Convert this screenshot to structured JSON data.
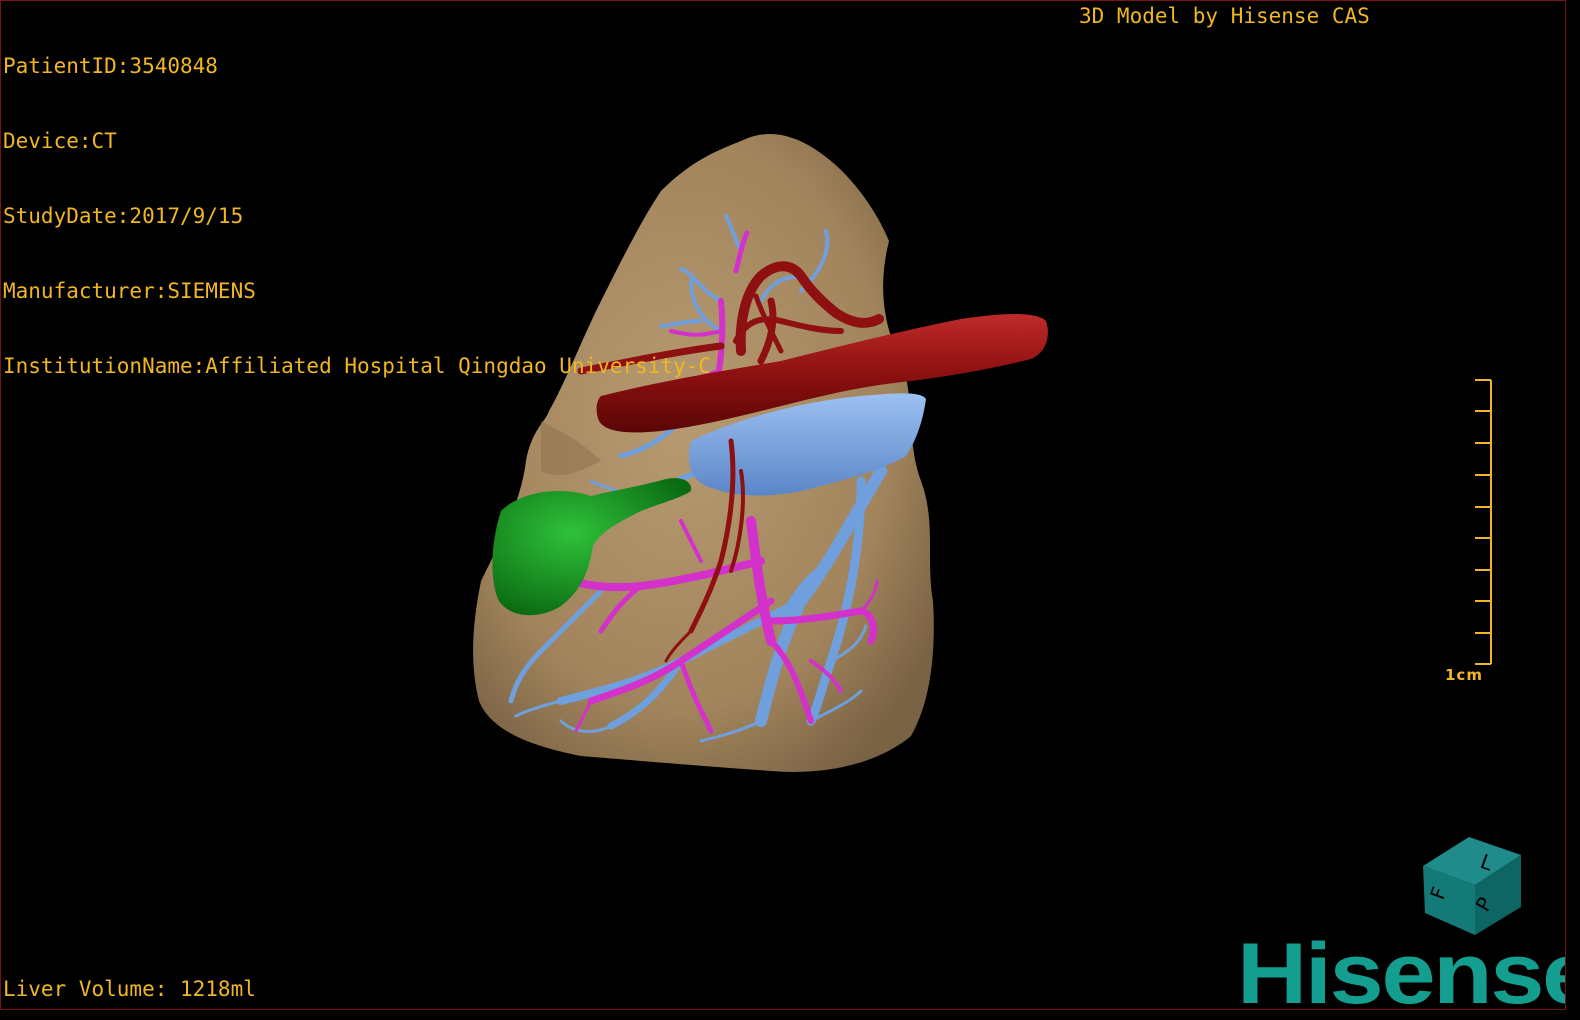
{
  "overlay": {
    "patient_id": "PatientID:3540848",
    "device": "Device:CT",
    "study_date": "StudyDate:2017/9/15",
    "manufacturer": "Manufacturer:SIEMENS",
    "institution": "InstitutionName:Affiliated Hospital Qingdao University-C",
    "credit": "3D Model by Hisense CAS",
    "liver_volume": "Liver Volume: 1218ml"
  },
  "scale_bar": {
    "label": "1cm",
    "ticks": 10
  },
  "orientation_cube": {
    "faces": [
      "F",
      "L",
      "P"
    ]
  },
  "brand": {
    "text": "Hisense"
  },
  "colors": {
    "overlay_text": "#f0b623",
    "liver": "#a98a62",
    "hepatic_vein": "#6f9fdc",
    "portal_vein": "#d430cc",
    "artery": "#8e1010",
    "gallbladder": "#14951f",
    "ivc": "#7ea8e6",
    "brand": "#139e8f",
    "frame": "#7a1414"
  }
}
